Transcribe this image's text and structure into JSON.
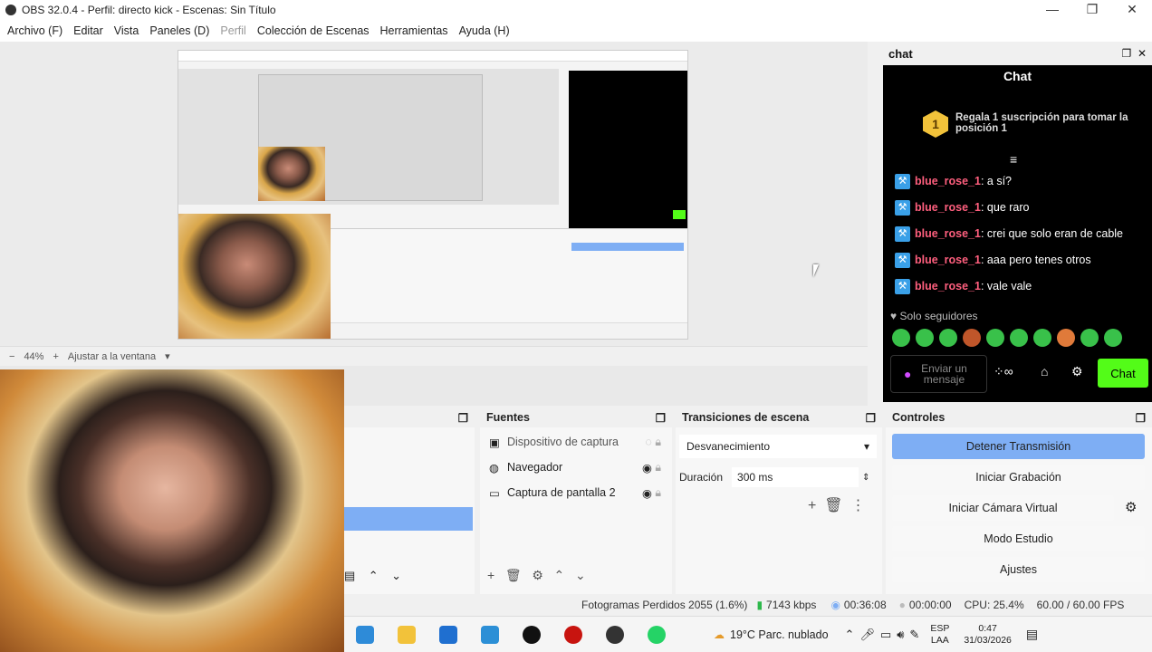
{
  "window": {
    "title": "OBS 32.0.4 - Perfil: directo kick - Escenas: Sin Título",
    "min": "—",
    "max": "❐",
    "close": "✕"
  },
  "menu": [
    "Archivo (F)",
    "Editar",
    "Vista",
    "Paneles (D)",
    "Perfil",
    "Colección de Escenas",
    "Herramientas",
    "Ayuda (H)"
  ],
  "zoom": {
    "value": "44%",
    "fit": "Ajustar a la ventana"
  },
  "chat": {
    "dock_title": "chat",
    "panel_title": "Chat",
    "gift_number": "1",
    "gift_text": "Regala 1 suscripción para tomar la posición 1",
    "messages": [
      {
        "user": "blue_rose_1",
        "text": ": a sí?"
      },
      {
        "user": "blue_rose_1",
        "text": ": que raro"
      },
      {
        "user": "blue_rose_1",
        "text": ": crei que solo eran de cable"
      },
      {
        "user": "blue_rose_1",
        "text": ": aaa pero tenes otros"
      },
      {
        "user": "blue_rose_1",
        "text": ": vale vale"
      }
    ],
    "followers_only": "Solo seguidores",
    "send_placeholder": "Enviar un mensaje",
    "chat_button": "Chat"
  },
  "docks": {
    "sources": "Fuentes",
    "transitions": "Transiciones de escena",
    "controls": "Controles"
  },
  "sources": [
    {
      "name": "Dispositivo de captura",
      "icon": "camera-icon"
    },
    {
      "name": "Navegador",
      "icon": "globe-icon"
    },
    {
      "name": "Captura de pantalla 2",
      "icon": "monitor-icon"
    }
  ],
  "transitions": {
    "type": "Desvanecimiento",
    "duration_label": "Duración",
    "duration": "300 ms"
  },
  "controls": [
    "Detener Transmisión",
    "Iniciar Grabación",
    "Iniciar Cámara Virtual",
    "Modo Estudio",
    "Ajustes"
  ],
  "status": {
    "frames": "Fotogramas Perdidos 2055 (1.6%)",
    "kbps": "7143 kbps",
    "live": "00:36:08",
    "rec": "00:00:00",
    "cpu": "CPU: 25.4%",
    "fps": "60.00 / 60.00 FPS"
  },
  "taskbar": {
    "weather": "19°C Parc. nublado",
    "lang1": "ESP",
    "lang2": "LAA",
    "time": "0:47",
    "date": "31/03/2026"
  },
  "colors": {
    "kick_green": "#53fc18",
    "accent_blue": "#7eaef4",
    "chat_user": "#ff5f7e"
  }
}
